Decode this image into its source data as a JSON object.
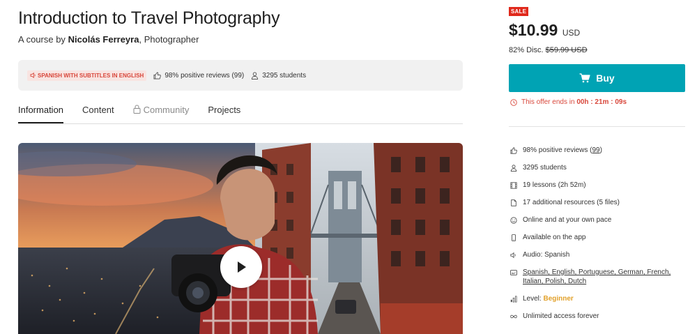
{
  "course": {
    "title": "Introduction to Travel Photography",
    "byline_prefix": "A course by",
    "author": "Nicolás Ferreyra",
    "author_suffix": ", Photographer"
  },
  "infobar": {
    "language_badge": "SPANISH WITH SUBTITLES IN ENGLISH",
    "reviews": "98% positive reviews (99)",
    "students": "3295 students"
  },
  "tabs": [
    {
      "label": "Information",
      "active": true
    },
    {
      "label": "Content"
    },
    {
      "label": "Community",
      "locked": true
    },
    {
      "label": "Projects"
    }
  ],
  "pricing": {
    "badge": "SALE",
    "amount": "$10.99",
    "currency": "USD",
    "discount_label": "82% Disc.",
    "original_price": "$59.99 USD",
    "buy_label": "Buy",
    "offer_prefix": "This offer ends in",
    "offer_time": "00h : 21m : 09s"
  },
  "features": {
    "reviews_prefix": "98% positive reviews (",
    "reviews_count": "99",
    "reviews_suffix": ")",
    "students": "3295 students",
    "lessons": "19 lessons (2h 52m)",
    "resources": "17 additional resources (5 files)",
    "pace": "Online and at your own pace",
    "app": "Available on the app",
    "audio": "Audio: Spanish",
    "subtitles_line1": "Spanish, English, Portuguese, German, French,",
    "subtitles_line2": "Italian, Polish, Dutch",
    "level_prefix": "Level:",
    "level_value": "Beginner",
    "access": "Unlimited access forever"
  },
  "colors": {
    "accent": "#00a3b4",
    "sale": "#e0291c",
    "alert": "#d8473b",
    "level": "#e2a12b"
  },
  "icons": [
    "speaker-icon",
    "thumbs-up-icon",
    "user-icon",
    "lock-icon",
    "cart-icon",
    "clock-icon",
    "lessons-icon",
    "file-icon",
    "smile-icon",
    "phone-icon",
    "audio-icon",
    "subtitles-icon",
    "level-bars-icon",
    "infinity-icon",
    "play-icon"
  ]
}
